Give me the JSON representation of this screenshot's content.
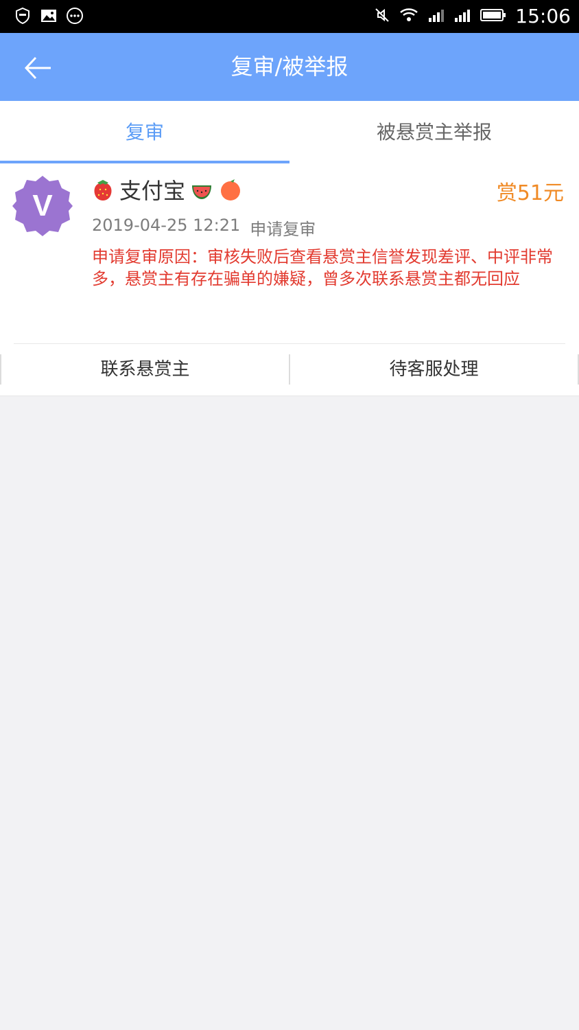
{
  "status_bar": {
    "time": "15:06",
    "icons": [
      "shield-icon",
      "image-icon",
      "more-icon",
      "mute-icon",
      "wifi-icon",
      "signal-icon",
      "signal2-icon",
      "battery-icon"
    ]
  },
  "app_bar": {
    "title": "复审/被举报",
    "back_icon": "back-arrow-icon",
    "color": "#6da4fb"
  },
  "tabs": [
    {
      "label": "复审",
      "active": true
    },
    {
      "label": "被悬赏主举报",
      "active": false
    }
  ],
  "card": {
    "name": "支付宝",
    "emojis": [
      "strawberry-icon",
      "watermelon-icon",
      "orange-icon"
    ],
    "reward": "赏51元",
    "datetime": "2019-04-25 12:21",
    "status": "申请复审",
    "reason": "申请复审原因：审核失败后查看悬赏主信誉发现差评、中评非常多，悬赏主有存在骗单的嫌疑，曾多次联系悬赏主都无回应",
    "actions": [
      {
        "label": "联系悬赏主"
      },
      {
        "label": "待客服处理"
      }
    ],
    "colors": {
      "reward": "#f08a25",
      "reason": "#e23a2f"
    }
  }
}
